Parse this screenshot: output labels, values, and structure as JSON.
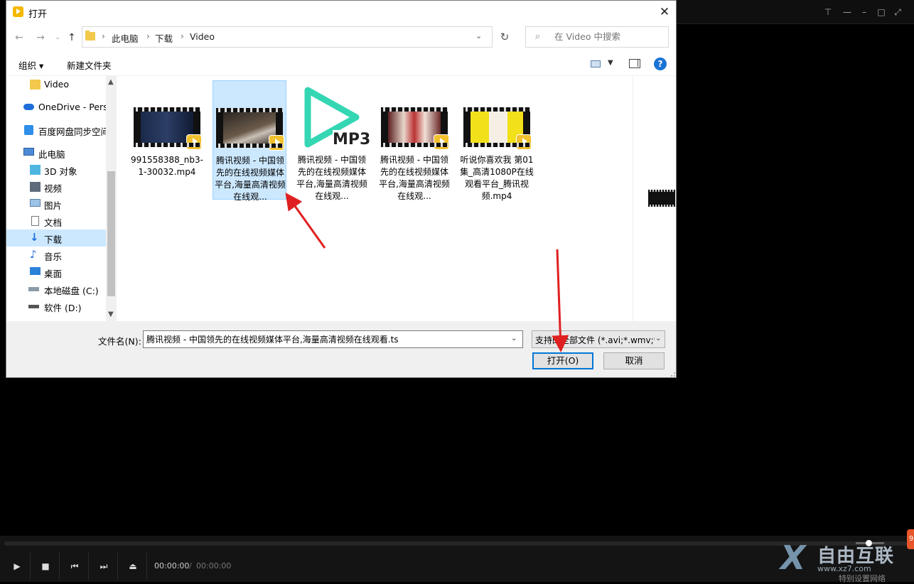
{
  "player": {
    "time_current": "00:00:00",
    "time_sep": "/",
    "time_total": "00:00:00",
    "watermark": {
      "text": "自由互联",
      "sub": "www.xz7.com",
      "hint": "特别设置网络"
    }
  },
  "dialog": {
    "title": "打开",
    "breadcrumbs": [
      "此电脑",
      "下载",
      "Video"
    ],
    "search_placeholder": "在 Video 中搜索",
    "toolbar": {
      "organize": "组织 ▾",
      "new_folder": "新建文件夹"
    },
    "nav_items": [
      {
        "label": "Video",
        "icon": "folder-icon"
      },
      {
        "label": "OneDrive - Perso",
        "icon": "onedrive-icon"
      },
      {
        "label": "百度网盘同步空间",
        "icon": "baidu-netdisk-icon"
      },
      {
        "label": "此电脑",
        "icon": "computer-icon"
      },
      {
        "label": "3D 对象",
        "icon": "cube-icon"
      },
      {
        "label": "视频",
        "icon": "video-icon"
      },
      {
        "label": "图片",
        "icon": "picture-icon"
      },
      {
        "label": "文档",
        "icon": "document-icon"
      },
      {
        "label": "下载",
        "icon": "download-icon",
        "selected": true
      },
      {
        "label": "音乐",
        "icon": "music-icon"
      },
      {
        "label": "桌面",
        "icon": "desktop-icon"
      },
      {
        "label": "本地磁盘 (C:)",
        "icon": "drive-icon"
      },
      {
        "label": "软件 (D:)",
        "icon": "drive-icon"
      }
    ],
    "files": [
      {
        "name": "991558388_nb3-1-30032.mp4",
        "kind": "video"
      },
      {
        "name": "腾讯视频 - 中国领先的在线视频媒体平台,海量高清视频在线观...",
        "kind": "video",
        "selected": true
      },
      {
        "name": "腾讯视频 - 中国领先的在线视频媒体平台,海量高清视频在线观...",
        "kind": "mp3"
      },
      {
        "name": "腾讯视频 - 中国领先的在线视频媒体平台,海量高清视频在线观...",
        "kind": "video"
      },
      {
        "name": "听说你喜欢我 第01集_高清1080P在线观看平台_腾讯视频.mp4",
        "kind": "video"
      }
    ],
    "filename_label": "文件名(N):",
    "filename_value": "腾讯视频 - 中国领先的在线视频媒体平台,海量高清视频在线观看.ts",
    "filetype_label": "支持的全部文件 (*.avi;*.wmv;*.",
    "open_label": "打开(O)",
    "cancel_label": "取消",
    "mp3_label": "MP3"
  },
  "colors": {
    "accent": "#0078d7",
    "selection": "#cce8ff",
    "annotation": "#e02020",
    "player_badge": "#f2c12e"
  }
}
